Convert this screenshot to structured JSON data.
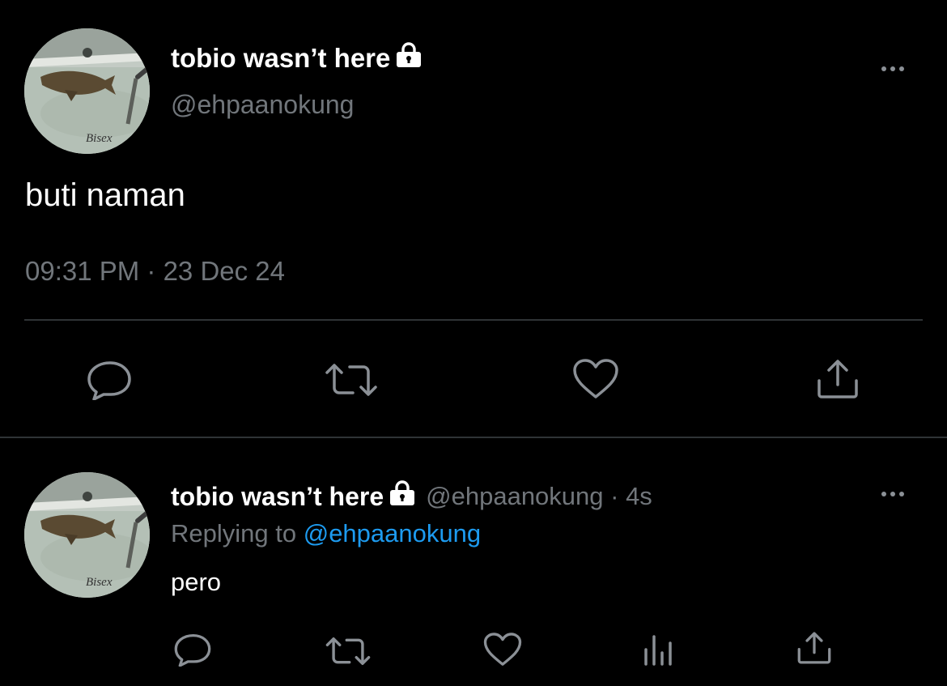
{
  "main_tweet": {
    "display_name": "tobio wasn’t here",
    "handle": "@ehpaanokung",
    "text": "buti naman",
    "timestamp": "09:31 PM · 23 Dec 24",
    "avatar_caption": "Bisex",
    "lock_icon": "lock-icon",
    "actions": [
      "reply-icon",
      "retweet-icon",
      "like-icon",
      "share-icon"
    ]
  },
  "reply_tweet": {
    "display_name": "tobio wasn’t here",
    "handle_time": "@ehpaanokung · 4s",
    "replying_to_label": "Replying to",
    "replying_to_handle": "@ehpaanokung",
    "text": "pero",
    "avatar_caption": "Bisex",
    "actions": [
      "reply-icon",
      "retweet-icon",
      "like-icon",
      "analytics-icon",
      "share-icon"
    ]
  },
  "colors": {
    "background": "#000000",
    "primary_text": "#ffffff",
    "secondary_text": "#71767b",
    "link": "#1d9bf0",
    "divider": "#2f3336",
    "icon": "#8b9096"
  }
}
